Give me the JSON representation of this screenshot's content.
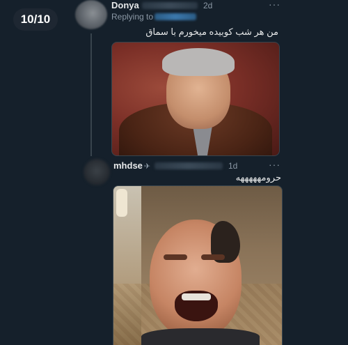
{
  "counter": "10/10",
  "tweet1": {
    "name": "Donya",
    "time": "2d",
    "replying_label": "Replying to",
    "text": "من هر شب کوبیده میخورم با سماق",
    "more": "···"
  },
  "tweet2": {
    "name": "mhdse",
    "name_icon": "✈",
    "time": "1d",
    "text": "حرومهههههه",
    "more": "···"
  },
  "colors": {
    "background": "#15202b",
    "secondary_text": "#8b98a5",
    "accent": "#1d9bf0"
  }
}
